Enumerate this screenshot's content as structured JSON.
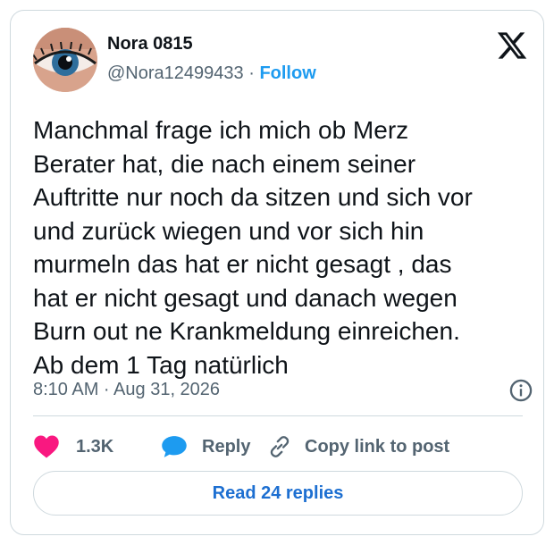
{
  "author": {
    "display_name": "Nora 0815",
    "handle": "@Nora12499433",
    "separator": "·",
    "follow_label": "Follow"
  },
  "tweet": {
    "text": "Manchmal frage ich mich ob Merz\nBerater hat, die nach einem seiner\nAuftritte nur noch da sitzen und sich vor\nund zurück wiegen und vor sich hin\nmurmeln das hat er nicht gesagt , das\nhat er nicht gesagt und danach wegen\nBurn out ne Krankmeldung einreichen.\nAb dem 1 Tag natürlich",
    "timestamp": "8:10 AM · Aug 31, 2026"
  },
  "actions": {
    "like_count": "1.3K",
    "reply_label": "Reply",
    "copy_label": "Copy link to post"
  },
  "footer": {
    "read_replies_label": "Read 24 replies"
  },
  "colors": {
    "accent": "#1d9bf0",
    "heart": "#f91880",
    "reply_icon": "#1d9bf0",
    "muted_text": "#536471",
    "border": "#cfd9de"
  },
  "icons": {
    "brand": "x-logo-icon",
    "like": "heart-icon",
    "reply": "speech-bubble-icon",
    "copy": "link-icon",
    "info": "info-icon"
  }
}
